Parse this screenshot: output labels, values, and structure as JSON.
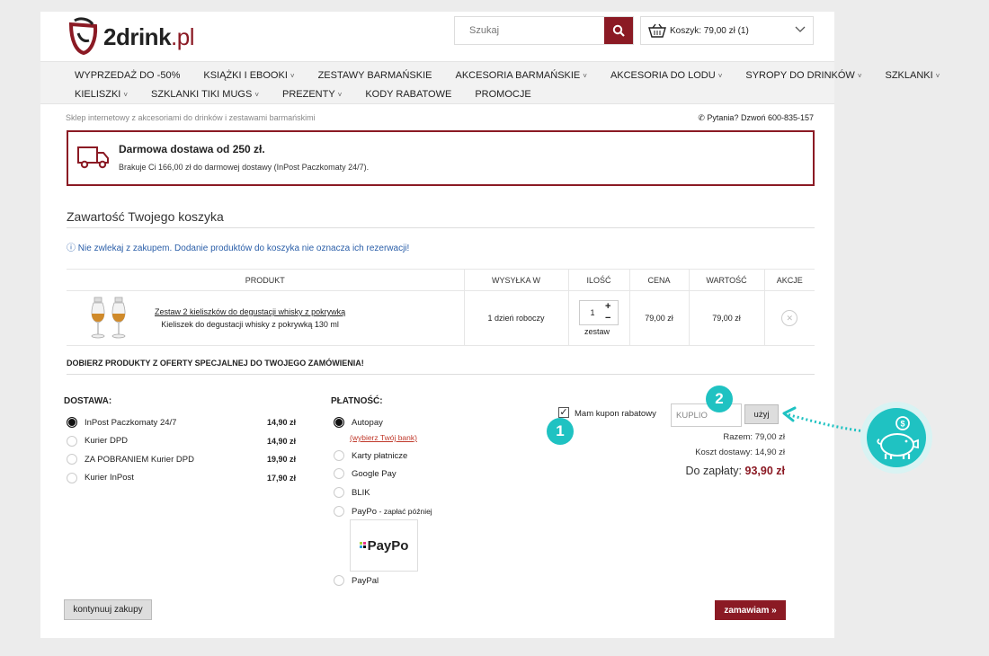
{
  "header": {
    "logo_text": "2drink",
    "logo_tld": ".pl",
    "search_placeholder": "Szukaj",
    "cart_label": "Koszyk: 79,00 zł (1)"
  },
  "nav": {
    "row1": [
      {
        "label": "WYPRZEDAŻ DO -50%",
        "caret": false
      },
      {
        "label": "KSIĄŻKI I EBOOKI",
        "caret": true
      },
      {
        "label": "ZESTAWY BARMAŃSKIE",
        "caret": false
      },
      {
        "label": "AKCESORIA BARMAŃSKIE",
        "caret": true
      },
      {
        "label": "AKCESORIA DO LODU",
        "caret": true
      },
      {
        "label": "SYROPY DO DRINKÓW",
        "caret": true
      },
      {
        "label": "SZKLANKI",
        "caret": true
      }
    ],
    "row2": [
      {
        "label": "KIELISZKI",
        "caret": true
      },
      {
        "label": "SZKLANKI TIKI MUGS",
        "caret": true
      },
      {
        "label": "PREZENTY",
        "caret": true
      },
      {
        "label": "KODY RABATOWE",
        "caret": false
      },
      {
        "label": "PROMOCJE",
        "caret": false
      }
    ]
  },
  "tagline": "Sklep internetowy z akcesoriami do drinków i zestawami barmańskimi",
  "phone": "Pytania? Dzwoń 600-835-157",
  "free_shipping": {
    "title": "Darmowa dostawa od 250 zł.",
    "subtitle": "Brakuje Ci 166,00 zł do darmowej dostawy (InPost Paczkomaty 24/7)."
  },
  "cart_title": "Zawartość Twojego koszyka",
  "info_msg": "Nie zwlekaj z zakupem. Dodanie produktów do koszyka nie oznacza ich rezerwacji!",
  "table": {
    "headers": [
      "PRODUKT",
      "WYSYŁKA W",
      "ILOŚĆ",
      "CENA",
      "WARTOŚĆ",
      "AKCJE"
    ],
    "row": {
      "name": "Zestaw 2 kieliszków do degustacji whisky z pokrywką",
      "desc": "Kieliszek do degustacji whisky z pokrywką 130 ml",
      "shipping": "1 dzień roboczy",
      "qty": "1",
      "unit": "zestaw",
      "price": "79,00 zł",
      "value": "79,00 zł"
    }
  },
  "offer_title": "DOBIERZ PRODUKTY Z OFERTY SPECJALNEJ DO TWOJEGO ZAMÓWIENIA!",
  "delivery": {
    "title": "DOSTAWA:",
    "options": [
      {
        "label": "InPost Paczkomaty 24/7",
        "price": "14,90 zł",
        "selected": true
      },
      {
        "label": "Kurier DPD",
        "price": "14,90 zł",
        "selected": false
      },
      {
        "label": "ZA POBRANIEM Kurier DPD",
        "price": "19,90 zł",
        "selected": false
      },
      {
        "label": "Kurier InPost",
        "price": "17,90 zł",
        "selected": false
      }
    ]
  },
  "payment": {
    "title": "PŁATNOŚĆ:",
    "autopay": "Autopay",
    "autopay_link": "(wybierz Twój bank)",
    "cards": "Karty płatnicze",
    "gpay": "Google Pay",
    "blik": "BLIK",
    "paypo": "PayPo",
    "paypo_note": "- zapłać później",
    "paypo_logo": "PayPo",
    "paypal": "PayPal"
  },
  "coupon": {
    "label": "Mam kupon rabatowy",
    "value": "KUPLIO",
    "button": "użyj"
  },
  "summary": {
    "subtotal": "Razem: 79,00 zł",
    "shipping": "Koszt dostawy: 14,90 zł",
    "total_label": "Do zapłaty:",
    "total_value": "93,90 zł"
  },
  "buttons": {
    "continue": "kontynuuj zakupy",
    "order": "zamawiam »"
  },
  "annotations": {
    "badge1": "1",
    "badge2": "2"
  },
  "colors": {
    "brand": "#8b1a24",
    "accent_annotation": "#1fc2c2",
    "link_blue": "#2a5ea8"
  }
}
